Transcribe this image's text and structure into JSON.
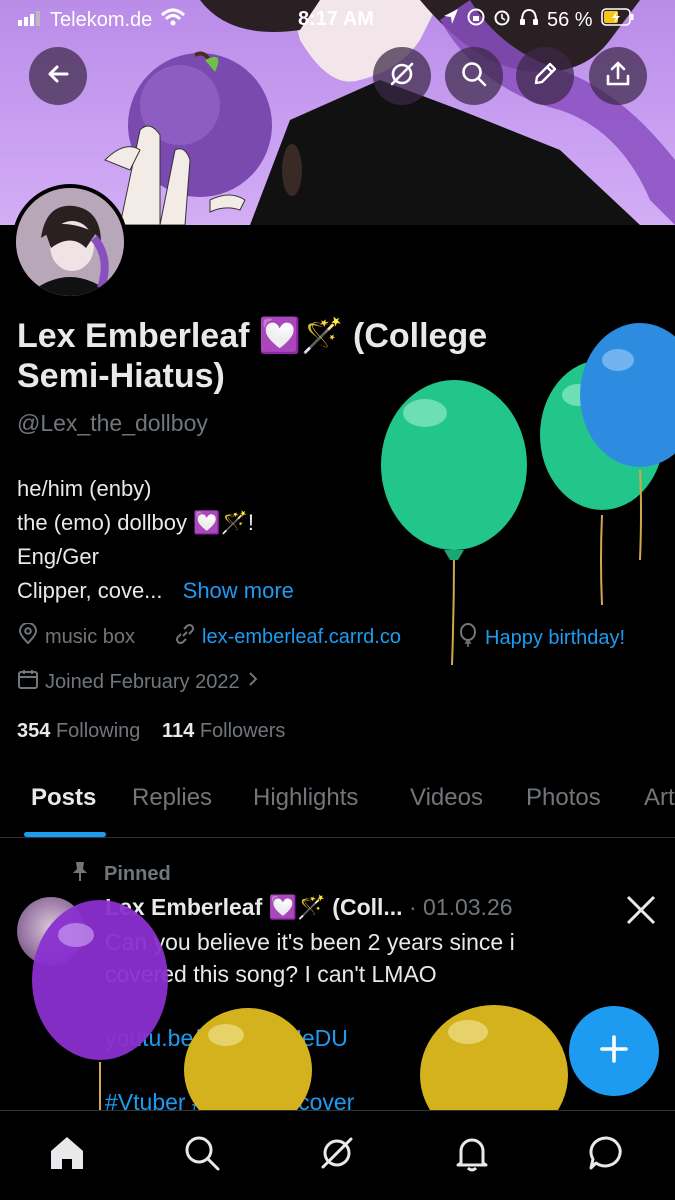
{
  "status_bar": {
    "carrier": "Telekom.de",
    "time": "8:17 AM",
    "battery": "56 %"
  },
  "header_buttons": [
    "back-icon",
    "grok-icon",
    "search-icon",
    "edit-icon",
    "share-icon"
  ],
  "profile": {
    "display_name": "Lex Emberleaf 💟🪄 (College Semi-Hiatus)",
    "handle": "@Lex_the_dollboy",
    "bio_lines": [
      "he/him (enby)",
      "the (emo) dollboy 💟🪄!",
      "Eng/Ger"
    ],
    "bio_truncated": "Clipper, cove...",
    "show_more": "Show more",
    "location": "music box",
    "website": "lex-emberleaf.carrd.co",
    "birthday": "Happy birthday!",
    "joined": "Joined February 2022",
    "following_count": "354",
    "following_label": "Following",
    "followers_count": "114",
    "followers_label": "Followers"
  },
  "tabs": [
    "Posts",
    "Replies",
    "Highlights",
    "Videos",
    "Photos",
    "Articles"
  ],
  "active_tab": "Posts",
  "post": {
    "pinned_label": "Pinned",
    "author": "Lex Emberleaf 💟🪄 (Coll...",
    "date": "· 01.03.26",
    "text": "Can you believe it's been 2 years since i covered this song? I can't LMAO",
    "link": "youtu.be/3rPJZhxUeDU",
    "hashtags": "#Vtuber #vsinger #cover"
  },
  "colors": {
    "accent": "#1d9bf0",
    "secondary_text": "#71767b",
    "primary_text": "#e7e9ea",
    "background": "#000000",
    "banner": "#c9a0f2"
  }
}
